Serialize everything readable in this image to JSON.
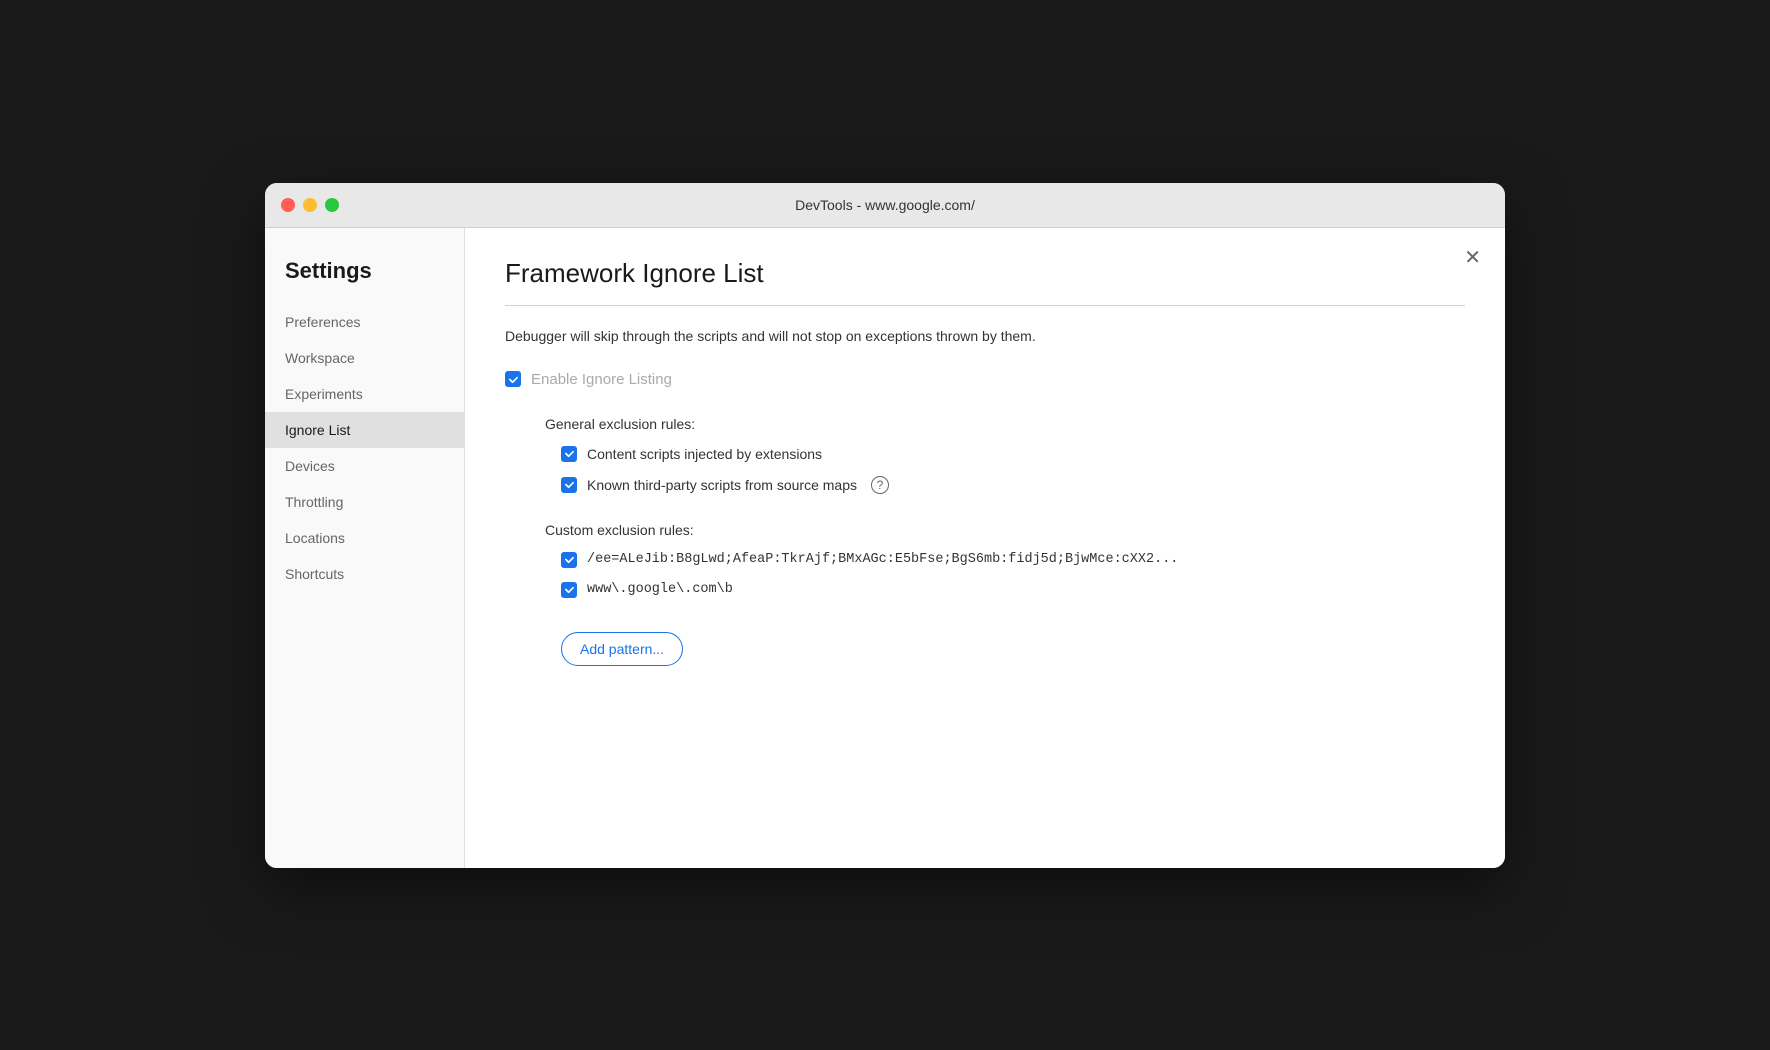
{
  "titlebar": {
    "title": "DevTools - www.google.com/"
  },
  "sidebar": {
    "heading": "Settings",
    "items": [
      {
        "id": "preferences",
        "label": "Preferences",
        "active": false
      },
      {
        "id": "workspace",
        "label": "Workspace",
        "active": false
      },
      {
        "id": "experiments",
        "label": "Experiments",
        "active": false
      },
      {
        "id": "ignore-list",
        "label": "Ignore List",
        "active": true
      },
      {
        "id": "devices",
        "label": "Devices",
        "active": false
      },
      {
        "id": "throttling",
        "label": "Throttling",
        "active": false
      },
      {
        "id": "locations",
        "label": "Locations",
        "active": false
      },
      {
        "id": "shortcuts",
        "label": "Shortcuts",
        "active": false
      }
    ]
  },
  "main": {
    "title": "Framework Ignore List",
    "description": "Debugger will skip through the scripts and will not stop on exceptions thrown by them.",
    "enable_label": "Enable Ignore Listing",
    "general_section_label": "General exclusion rules:",
    "general_rules": [
      {
        "id": "content-scripts",
        "text": "Content scripts injected by extensions",
        "checked": true,
        "has_help": false
      },
      {
        "id": "third-party-scripts",
        "text": "Known third-party scripts from source maps",
        "checked": true,
        "has_help": true
      }
    ],
    "custom_section_label": "Custom exclusion rules:",
    "custom_rules": [
      {
        "id": "custom-rule-1",
        "text": "/ee=ALeJib:B8gLwd;AfeaP:TkrAjf;BMxAGc:E5bFse;BgS6mb:fidj5d;BjwMce:cXX2...",
        "checked": true
      },
      {
        "id": "custom-rule-2",
        "text": "www\\.google\\.com\\b",
        "checked": true
      }
    ],
    "add_pattern_label": "Add pattern...",
    "close_label": "✕"
  }
}
